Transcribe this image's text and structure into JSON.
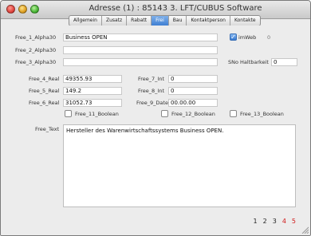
{
  "window": {
    "title": "Adresse (1) : 85143 3.  LFT/CUBUS Software"
  },
  "tabs": [
    {
      "label": "Allgemein",
      "active": false
    },
    {
      "label": "Zusatz",
      "active": false
    },
    {
      "label": "Rabatt",
      "active": false
    },
    {
      "label": "Frei",
      "active": true
    },
    {
      "label": "Bau",
      "active": false
    },
    {
      "label": "Kontaktperson",
      "active": false
    },
    {
      "label": "Kontakte",
      "active": false
    }
  ],
  "fields": {
    "free1": {
      "label": "Free_1_Alpha30",
      "value": "Business OPEN"
    },
    "free2": {
      "label": "Free_2_Alpha30",
      "value": ""
    },
    "free3": {
      "label": "Free_3_Alpha30",
      "value": ""
    },
    "imweb": {
      "label": "imWeb",
      "checked": true,
      "extra": "0"
    },
    "sno": {
      "label": "SNo Haltbarkeit",
      "value": "0"
    },
    "real4": {
      "label": "Free_4_Real",
      "value": "49355.93"
    },
    "real5": {
      "label": "Free_5_Real",
      "value": "149.2"
    },
    "real6": {
      "label": "Free_6_Real",
      "value": "31052.73"
    },
    "int7": {
      "label": "Free_7_Int",
      "value": "0"
    },
    "int8": {
      "label": "Free_8_Int",
      "value": "0"
    },
    "date9": {
      "label": "Free_9_Date",
      "value": "00.00.00"
    },
    "bool11": {
      "label": "Free_11_Boolean",
      "checked": false
    },
    "bool12": {
      "label": "Free_12_Boolean",
      "checked": false
    },
    "bool13": {
      "label": "Free_13_Boolean",
      "checked": false
    },
    "freetext": {
      "label": "Free_Text",
      "value": "Hersteller des Warenwirtschaftssystems Business OPEN."
    }
  },
  "pager": {
    "pages": [
      "1",
      "2",
      "3",
      "4",
      "5"
    ],
    "colors": [
      "#222222",
      "#222222",
      "#222222",
      "#d01818",
      "#d01818"
    ]
  }
}
